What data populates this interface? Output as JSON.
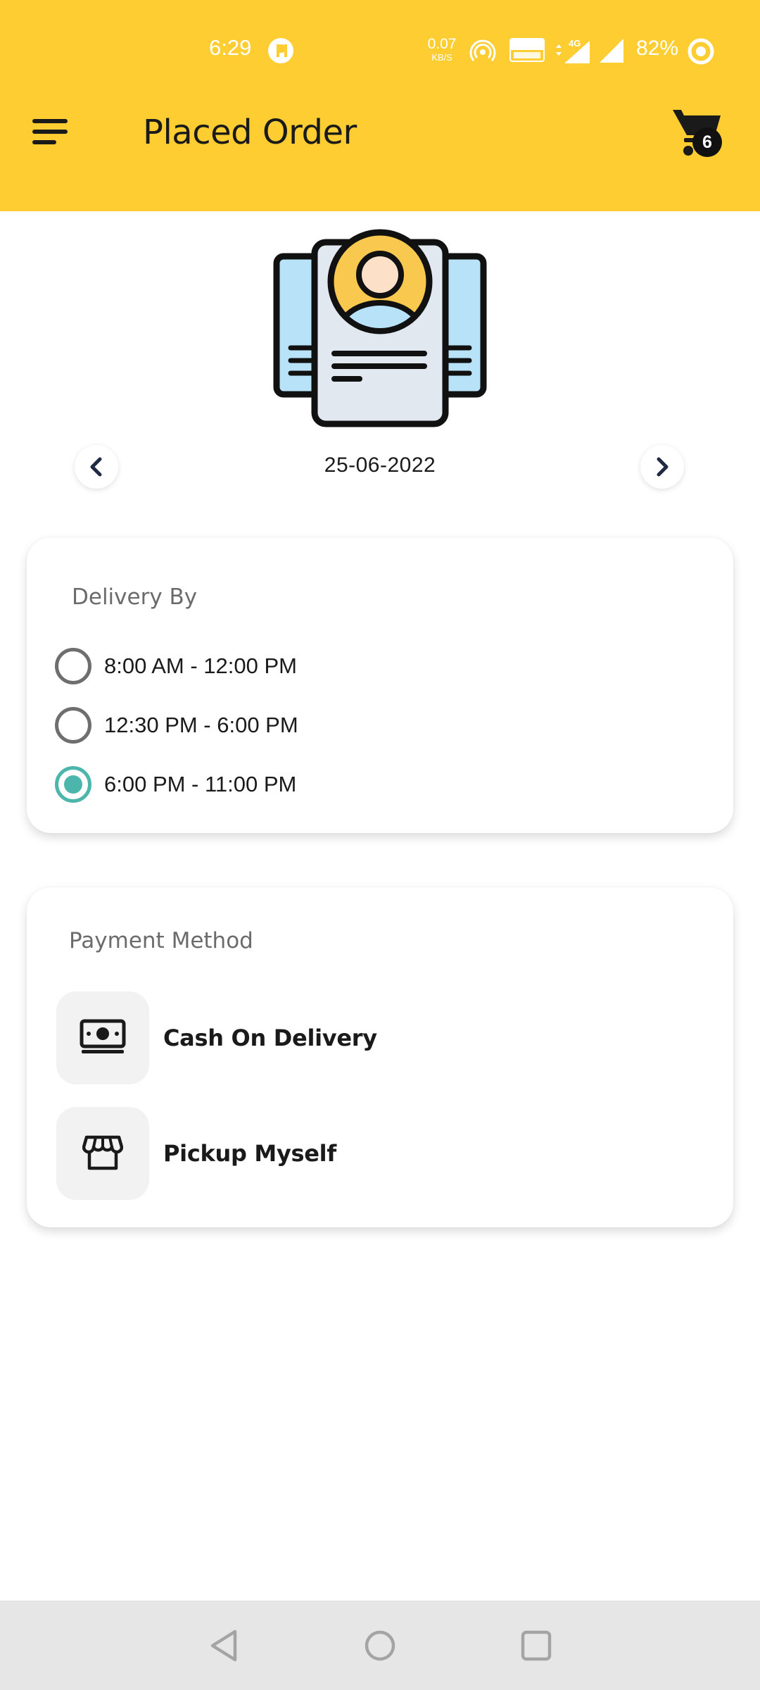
{
  "status_bar": {
    "time": "6:29",
    "speed_value": "0.07",
    "speed_unit": "KB/S",
    "battery": "82%",
    "icons": [
      "app-notification-icon",
      "hotspot-icon",
      "volte-icon",
      "4g-icon",
      "signal-icon",
      "battery-icon"
    ]
  },
  "header": {
    "title": "Placed Order",
    "cart_count": "6",
    "background_color": "#FECD32",
    "menu_icon": "hamburger-menu-icon",
    "cart_icon": "cart-icon"
  },
  "hero": {
    "icon": "profile-document-icon"
  },
  "date_nav": {
    "date": "25-06-2022",
    "prev_icon": "chevron-left-icon",
    "next_icon": "chevron-right-icon"
  },
  "delivery": {
    "title": "Delivery By",
    "accent_color": "#4DB6AC",
    "options": [
      {
        "label": "8:00 AM - 12:00 PM",
        "selected": false
      },
      {
        "label": "12:30 PM - 6:00 PM",
        "selected": false
      },
      {
        "label": "6:00 PM - 11:00 PM",
        "selected": true
      }
    ]
  },
  "payment": {
    "title": "Payment Method",
    "methods": [
      {
        "label": "Cash On Delivery",
        "icon": "cash-icon"
      },
      {
        "label": "Pickup Myself",
        "icon": "store-icon"
      }
    ]
  },
  "nav_bar": {
    "buttons": [
      "back-icon",
      "home-icon",
      "recents-icon"
    ]
  }
}
